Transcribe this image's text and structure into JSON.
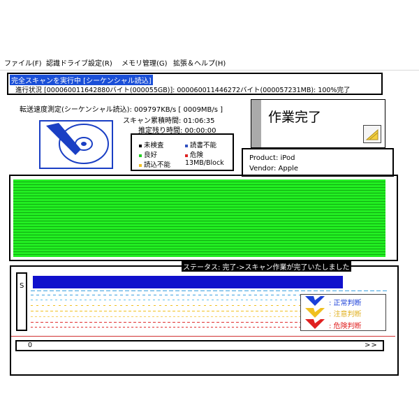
{
  "menu": {
    "items": [
      {
        "label": "ファイル(F)"
      },
      {
        "label": "認識ドライブ設定(R)"
      },
      {
        "label": "メモリ管理(G)"
      },
      {
        "label": "拡張＆ヘルプ(H)"
      }
    ]
  },
  "scan": {
    "title": "完全スキャンを実行中 [シーケンシャル読込]",
    "progress": "進行状況 [000060011642880バイト(000055GB)]: 000060011446272バイト(000057231MB): 100%完了"
  },
  "speed": {
    "line": "転送速度測定(シーケンシャル読込): 009797KB/s [ 0009MB/s ]",
    "elapsed": "スキャン累積時間: 01:06:35",
    "remaining": "推定残り時間: 00:00:00"
  },
  "legend": {
    "unchecked": "未検査",
    "write_fail": "読書不能",
    "good": "良好",
    "danger": "危険",
    "read_fail": "読込不能",
    "block_size": "13MB/Block",
    "colors": {
      "unchecked": "#000000",
      "write_fail": "#3050c0",
      "good": "#22cc22",
      "danger": "#dd2222",
      "read_fail": "#f0c020"
    }
  },
  "complete": {
    "label": "作業完了"
  },
  "device": {
    "product": "Product: iPod",
    "vendor": "Vendor: Apple"
  },
  "status": {
    "text": "ステータス: 完了->スキャン作業が完了いたしました",
    "s_label": "S"
  },
  "judge": {
    "normal": ": 正常判断",
    "caution": ": 注意判断",
    "danger": ": 危険判断",
    "colors": {
      "normal": "#1a3fd8",
      "caution": "#f0c020",
      "danger": "#e02020"
    }
  },
  "nav": {
    "start": "0",
    "next": ">>"
  }
}
